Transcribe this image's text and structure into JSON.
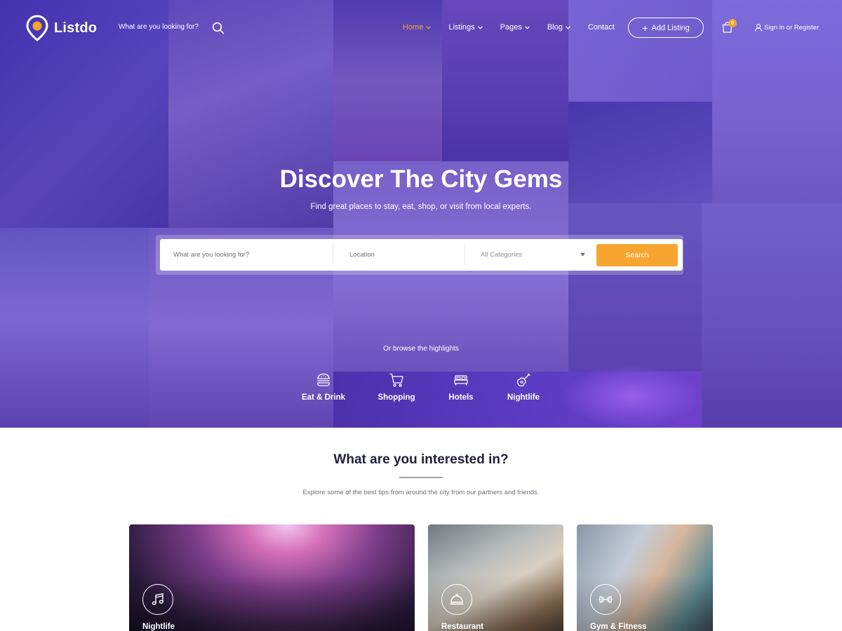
{
  "brand": {
    "name": "Listdo",
    "accent": "#f6a531",
    "hero_tint": "#4c34d6"
  },
  "header": {
    "search_placeholder": "What are you looking for?",
    "nav": [
      {
        "label": "Home",
        "active": true,
        "dropdown": true
      },
      {
        "label": "Listings",
        "active": false,
        "dropdown": true
      },
      {
        "label": "Pages",
        "active": false,
        "dropdown": true
      },
      {
        "label": "Blog",
        "active": false,
        "dropdown": true
      },
      {
        "label": "Contact",
        "active": false,
        "dropdown": false
      }
    ],
    "add_listing_label": "Add Listing",
    "cart_count": "0",
    "signin_label": "Sign in or Register"
  },
  "hero": {
    "title": "Discover The City Gems",
    "subtitle": "Find great places to stay, eat, shop, or visit from local experts.",
    "search": {
      "what_placeholder": "What are you looking for?",
      "location_placeholder": "Location",
      "category_selected": "All Categories",
      "button_label": "Search"
    },
    "browse_label": "Or browse the highlights",
    "highlights": [
      {
        "label": "Eat & Drink",
        "icon": "burger-icon"
      },
      {
        "label": "Shopping",
        "icon": "cart-icon"
      },
      {
        "label": "Hotels",
        "icon": "bed-icon"
      },
      {
        "label": "Nightlife",
        "icon": "guitar-icon"
      }
    ]
  },
  "interests": {
    "title": "What are you interested in?",
    "subtitle": "Explore some of the best tips from around the city from our partners and friends.",
    "cards": [
      {
        "label": "Nightlife",
        "icon": "music-note-icon"
      },
      {
        "label": "Restaurant",
        "icon": "cloche-icon"
      },
      {
        "label": "Gym & Fitness",
        "icon": "dumbbell-icon"
      }
    ]
  }
}
